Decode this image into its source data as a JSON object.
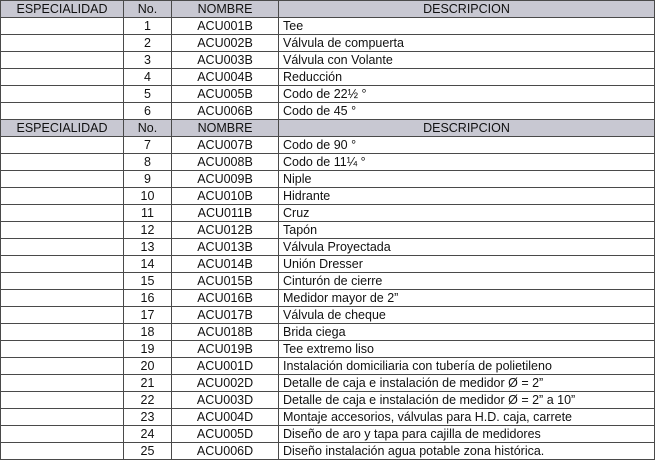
{
  "headers": {
    "especialidad": "ESPECIALIDAD",
    "no": "No.",
    "nombre": "NOMBRE",
    "descripcion": "DESCRIPCION"
  },
  "group1": [
    {
      "no": "1",
      "nombre": "ACU001B",
      "descripcion": "Tee"
    },
    {
      "no": "2",
      "nombre": "ACU002B",
      "descripcion": "Válvula de compuerta"
    },
    {
      "no": "3",
      "nombre": "ACU003B",
      "descripcion": "Válvula con Volante"
    },
    {
      "no": "4",
      "nombre": "ACU004B",
      "descripcion": "Reducción"
    },
    {
      "no": "5",
      "nombre": "ACU005B",
      "descripcion": "Codo de 22½ °"
    },
    {
      "no": "6",
      "nombre": "ACU006B",
      "descripcion": "Codo de 45 °"
    }
  ],
  "group2": [
    {
      "no": "7",
      "nombre": "ACU007B",
      "descripcion": "Codo de 90 °"
    },
    {
      "no": "8",
      "nombre": "ACU008B",
      "descripcion": "Codo de 11¼ °"
    },
    {
      "no": "9",
      "nombre": "ACU009B",
      "descripcion": "Niple"
    },
    {
      "no": "10",
      "nombre": "ACU010B",
      "descripcion": "Hidrante"
    },
    {
      "no": "11",
      "nombre": "ACU011B",
      "descripcion": "Cruz"
    },
    {
      "no": "12",
      "nombre": "ACU012B",
      "descripcion": "Tapón"
    },
    {
      "no": "13",
      "nombre": "ACU013B",
      "descripcion": "Válvula Proyectada"
    },
    {
      "no": "14",
      "nombre": "ACU014B",
      "descripcion": "Unión Dresser"
    },
    {
      "no": "15",
      "nombre": "ACU015B",
      "descripcion": "Cinturón de cierre"
    },
    {
      "no": "16",
      "nombre": "ACU016B",
      "descripcion": "Medidor mayor de 2”"
    },
    {
      "no": "17",
      "nombre": "ACU017B",
      "descripcion": "Válvula de cheque"
    },
    {
      "no": "18",
      "nombre": "ACU018B",
      "descripcion": "Brida ciega"
    },
    {
      "no": "19",
      "nombre": "ACU019B",
      "descripcion": "Tee extremo liso"
    },
    {
      "no": "20",
      "nombre": "ACU001D",
      "descripcion": "Instalación domiciliaria con tubería de polietileno"
    },
    {
      "no": "21",
      "nombre": "ACU002D",
      "descripcion": "Detalle de caja e instalación de medidor Ø = 2”"
    },
    {
      "no": "22",
      "nombre": "ACU003D",
      "descripcion": "Detalle de caja e instalación de medidor Ø = 2” a 10”"
    },
    {
      "no": "23",
      "nombre": "ACU004D",
      "descripcion": "Montaje accesorios, válvulas para H.D. caja, carrete"
    },
    {
      "no": "24",
      "nombre": "ACU005D",
      "descripcion": "Diseño de aro y tapa para cajilla de medidores"
    },
    {
      "no": "25",
      "nombre": "ACU006D",
      "descripcion": "Diseño instalación agua potable zona histórica."
    }
  ]
}
